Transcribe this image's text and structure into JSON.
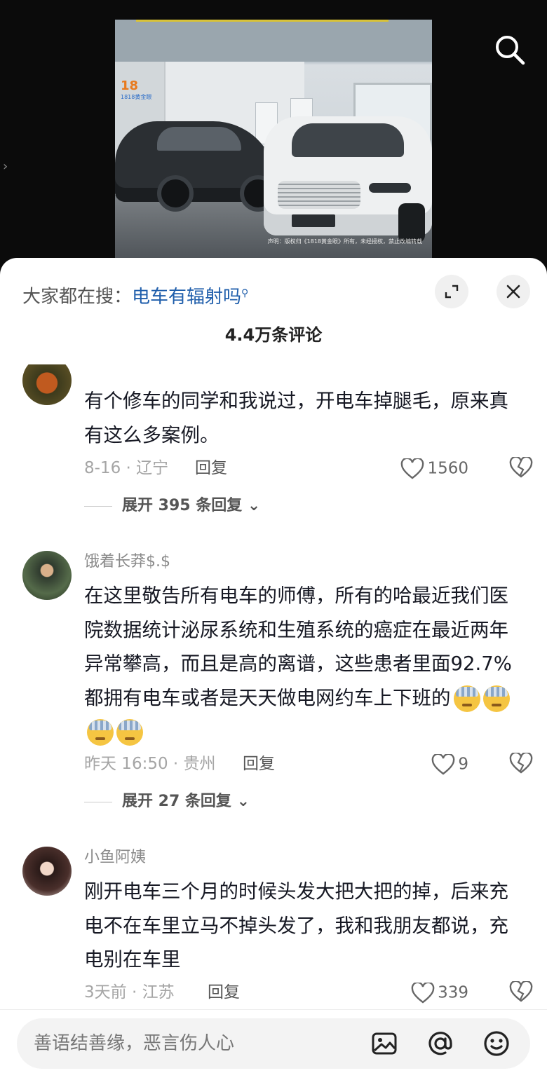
{
  "video": {
    "logo_text": "18",
    "logo_sub": "1818黄金眼",
    "watermark": "声明：版权归《1818黄金眼》所有，未经授权，禁止改编转载"
  },
  "header": {
    "suggest_prefix": "大家都在搜：",
    "suggest_term": "电车有辐射吗",
    "comment_count": "4.4万条评论"
  },
  "comments": [
    {
      "username": "",
      "text": "有个修车的同学和我说过，开电车掉腿毛，原来真有这么多案例。",
      "time": "8-16 · 辽宁",
      "reply_label": "回复",
      "likes": "1560",
      "expand_label": "展开 395 条回复"
    },
    {
      "username": "饿着长莽$.$",
      "text": "在这里敬告所有电车的师傅，所有的哈最近我们医院数据统计泌尿系统和生殖系统的癌症在最近两年异常攀高，而且是高的离谱，这些患者里面92.7%都拥有电车或者是天天做电网约车上下班的",
      "time": "昨天 16:50 · 贵州",
      "reply_label": "回复",
      "likes": "9",
      "expand_label": "展开 27 条回复"
    },
    {
      "username": "小鱼阿姨",
      "text": "刚开电车三个月的时候头发大把大把的掉，后来充电不在车里立马不掉头发了，我和我朋友都说，充电别在车里",
      "time": "3天前 · 江苏",
      "reply_label": "回复",
      "likes": "339",
      "expand_label": ""
    }
  ],
  "input": {
    "placeholder": "善语结善缘，恶言伤人心"
  },
  "icons": [
    "search-icon",
    "chevron-right-icon",
    "expand-icon",
    "close-icon",
    "heart-icon",
    "broken-heart-icon",
    "chevron-down-icon",
    "image-icon",
    "at-icon",
    "emoji-icon"
  ],
  "colors": {
    "link_blue": "#1f5eab",
    "sheet_bg": "#ffffff",
    "video_bg": "#0b0b0b"
  }
}
